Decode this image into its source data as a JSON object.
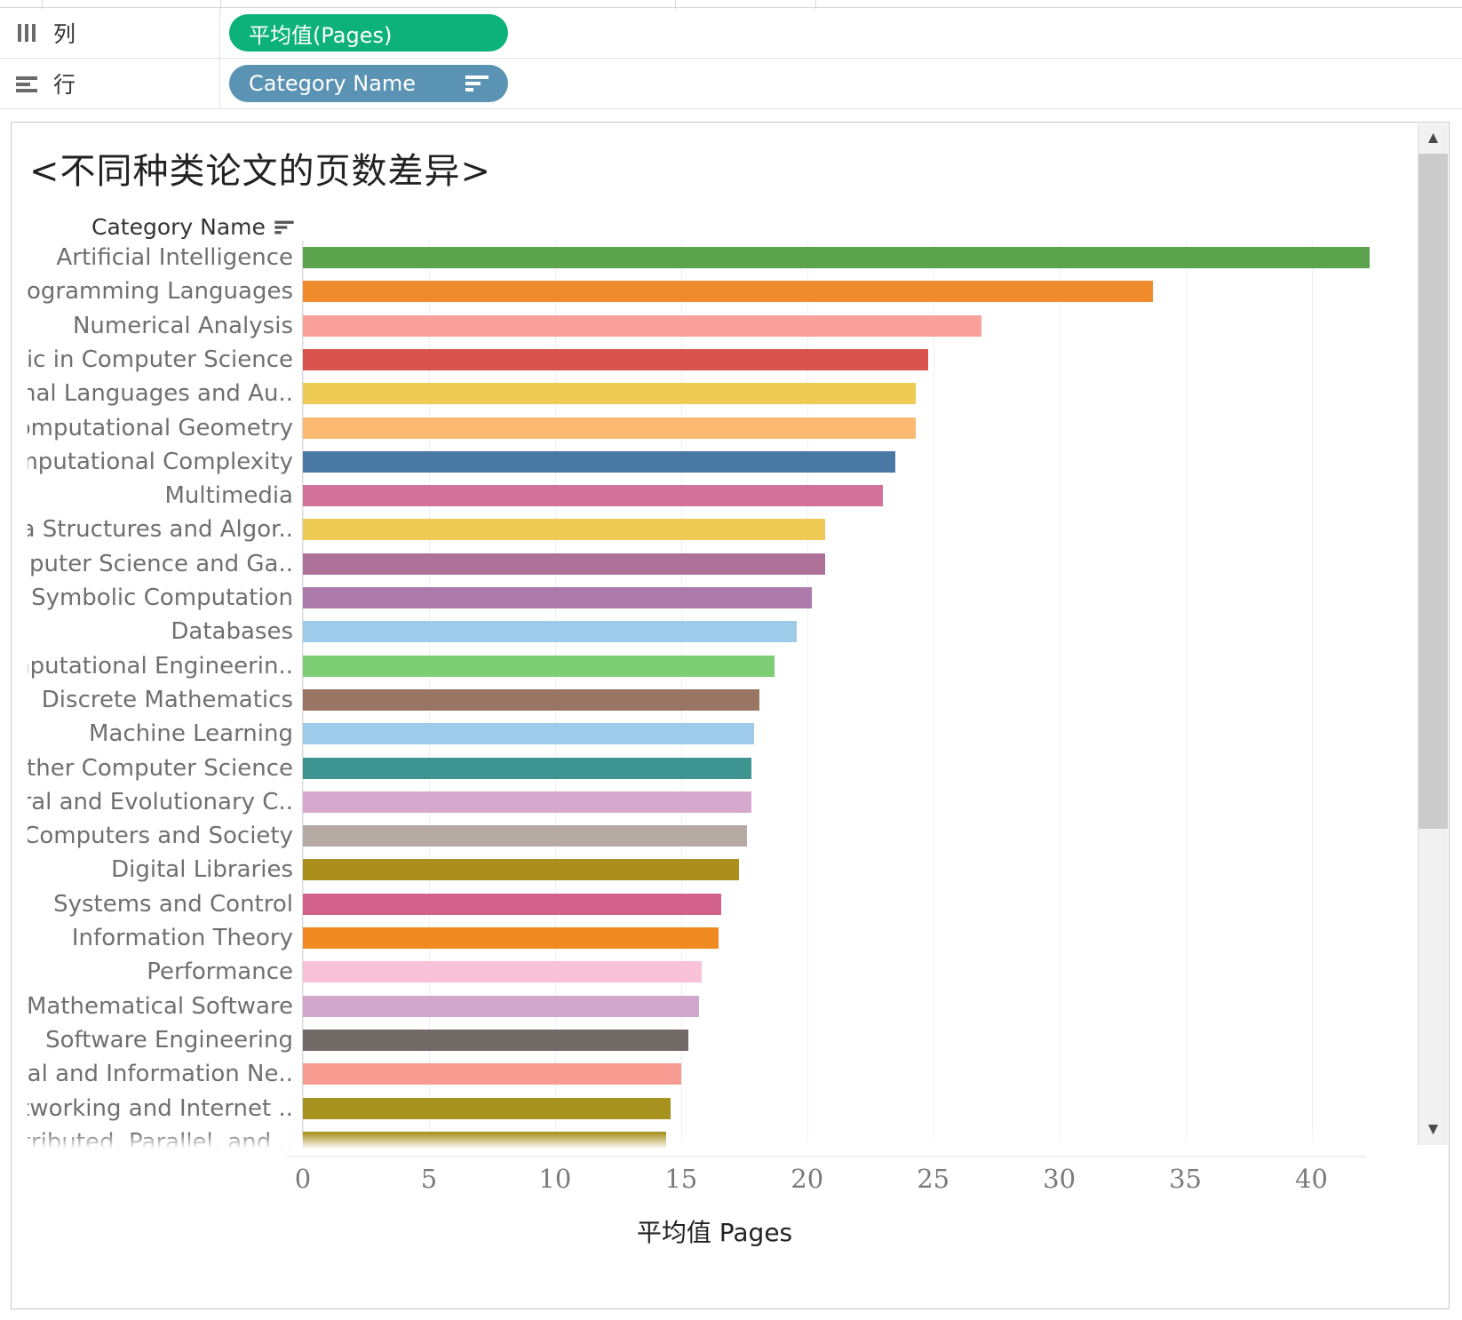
{
  "shelves": {
    "columns": {
      "label": "列",
      "icon": "columns-icon",
      "pill": "平均值(Pages)",
      "pill_color": "#0db27b"
    },
    "rows": {
      "label": "行",
      "icon": "rows-icon",
      "pill": "Category Name",
      "pill_color": "#5a93b3",
      "sort_icon": "sort-descending-icon"
    }
  },
  "viz": {
    "title": "<不同种类论文的页数差异>",
    "row_header": "Category Name",
    "row_header_sort_icon": "sort-descending-icon"
  },
  "scrollbar": {
    "up_icon": "chevron-up-icon",
    "down_icon": "chevron-down-icon"
  },
  "chart_data": {
    "type": "bar",
    "orientation": "horizontal",
    "title": "<不同种类论文的页数差异>",
    "xlabel": "平均值 Pages",
    "ylabel": "Category Name",
    "xlim": [
      0,
      42.8
    ],
    "xticks": [
      0,
      5,
      10,
      15,
      20,
      25,
      30,
      35,
      40
    ],
    "grid": true,
    "legend": "none",
    "categories": [
      "Artificial Intelligence",
      "Programming Languages",
      "Numerical Analysis",
      "Logic in Computer Science",
      "Formal Languages and Au..",
      "Computational Geometry",
      "Computational Complexity",
      "Multimedia",
      "Data Structures and Algor..",
      "Computer Science and Ga..",
      "Symbolic Computation",
      "Databases",
      "Computational Engineerin..",
      "Discrete Mathematics",
      "Machine Learning",
      "Other Computer Science",
      "Neural and Evolutionary C..",
      "Computers and Society",
      "Digital Libraries",
      "Systems and Control",
      "Information Theory",
      "Performance",
      "Mathematical Software",
      "Software Engineering",
      "Social and Information Ne..",
      "Networking and Internet ..",
      "Distributed, Parallel, and .."
    ],
    "values": [
      42.3,
      33.7,
      26.9,
      24.8,
      24.3,
      24.3,
      23.5,
      23.0,
      20.7,
      20.7,
      20.2,
      19.6,
      18.7,
      18.1,
      17.9,
      17.8,
      17.8,
      17.6,
      17.3,
      16.6,
      16.5,
      15.8,
      15.7,
      15.3,
      15.0,
      14.6,
      14.4
    ],
    "colors": [
      "#5ba34d",
      "#ef8b2c",
      "#fba19b",
      "#d9534f",
      "#eecb54",
      "#fbb972",
      "#4978a4",
      "#d2719a",
      "#eecb54",
      "#ae7199",
      "#ad7bab",
      "#9dcbe9",
      "#7ece75",
      "#9a7563",
      "#9dcbe9",
      "#3d9491",
      "#d6a7cf",
      "#b5aba4",
      "#ab8f1c",
      "#d2618c",
      "#f18a21",
      "#f9c2d8",
      "#d2a7ce",
      "#716a66",
      "#f89c91",
      "#a7911f",
      "#a7911f"
    ]
  }
}
